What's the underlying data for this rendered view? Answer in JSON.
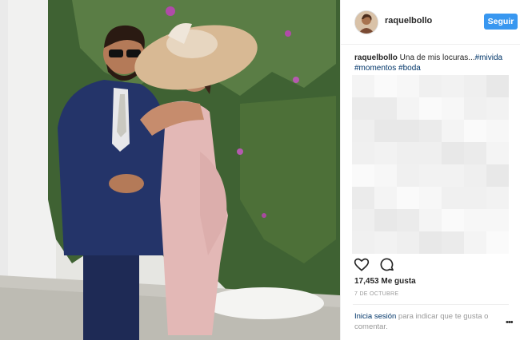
{
  "post": {
    "username": "raquelbollo",
    "follow_label": "Seguir",
    "caption_user": "raquelbollo",
    "caption_text": " Una de mis locuras...",
    "hashtags": [
      "#mivida",
      "#momentos",
      "#boda"
    ],
    "likes": "17,453 Me gusta",
    "date": "7 DE OCTUBRE",
    "login_link": "Inicia sesión",
    "login_rest": " para indicar que te gusta o comentar.",
    "more_label": "•••"
  },
  "icons": {
    "like": "heart-icon",
    "comment": "comment-icon",
    "more": "more-options-icon"
  },
  "colors": {
    "accent": "#3897f0",
    "hashtag": "#003569",
    "muted": "#999999"
  }
}
